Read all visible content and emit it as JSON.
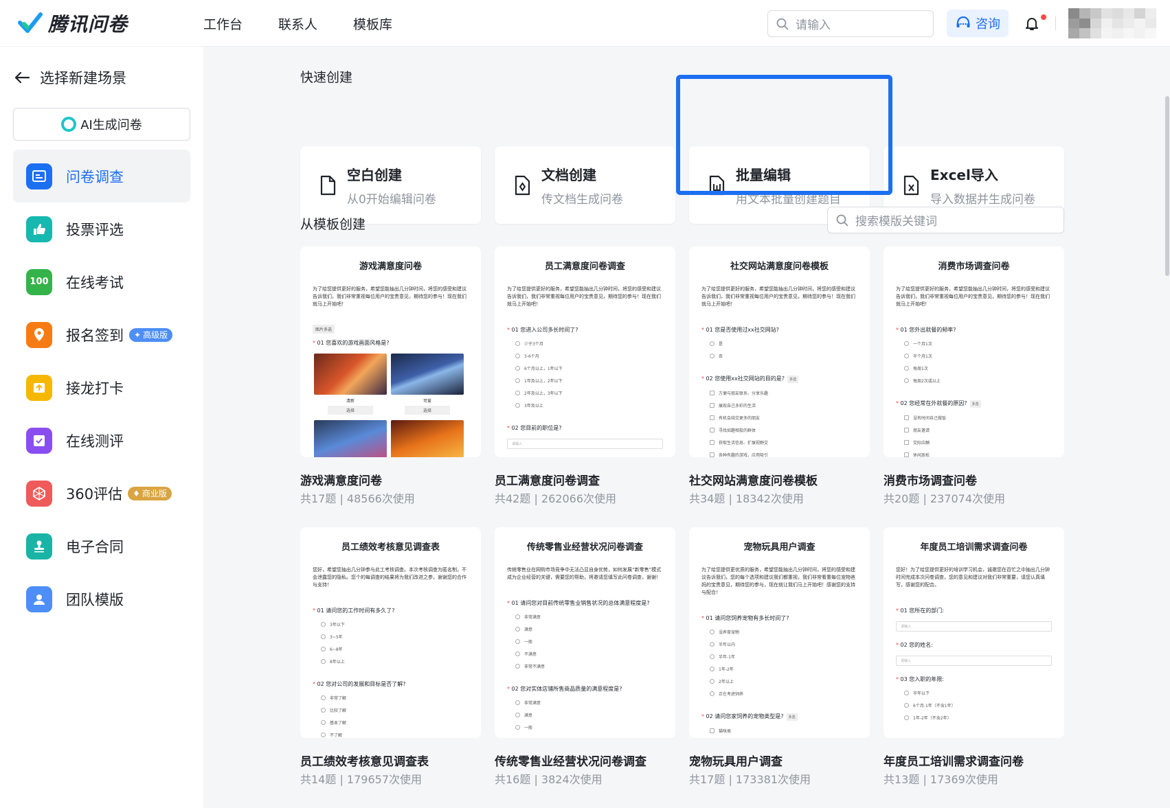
{
  "app": {
    "name": "腾讯问卷"
  },
  "nav": [
    "工作台",
    "联系人",
    "模板库"
  ],
  "header": {
    "search_placeholder": "请输入",
    "consult_label": "咨询"
  },
  "sidebar": {
    "title": "选择新建场景",
    "ai_button": "AI生成问卷",
    "items": [
      {
        "label": "问卷调查",
        "icon": "survey-icon",
        "color": "#1d6ff2",
        "active": true
      },
      {
        "label": "投票评选",
        "icon": "thumbs-up-icon",
        "color": "#17b8b0"
      },
      {
        "label": "在线考试",
        "icon": "score-100-icon",
        "color": "#34b34a"
      },
      {
        "label": "报名签到",
        "icon": "location-pin-icon",
        "color": "#f77b14",
        "badge": "高级版",
        "badge_color": "#4d8ef7"
      },
      {
        "label": "接龙打卡",
        "icon": "upload-icon",
        "color": "#f5b800"
      },
      {
        "label": "在线测评",
        "icon": "check-card-icon",
        "color": "#8a4ef0"
      },
      {
        "label": "360评估",
        "icon": "radar-icon",
        "color": "#ef5a5a",
        "badge": "商业版",
        "badge_color": "#d9a441"
      },
      {
        "label": "电子合同",
        "icon": "stamp-icon",
        "color": "#19b4a6"
      },
      {
        "label": "团队模版",
        "icon": "user-icon",
        "color": "#4d8ef7"
      }
    ]
  },
  "quick_create": {
    "title": "快速创建",
    "items": [
      {
        "title": "空白创建",
        "desc": "从0开始编辑问卷",
        "icon": "blank-file-icon"
      },
      {
        "title": "文档创建",
        "desc": "传文档生成问卷",
        "icon": "doc-create-icon"
      },
      {
        "title": "批量编辑",
        "desc": "用文本批量创建题目",
        "icon": "batch-edit-icon"
      },
      {
        "title": "Excel导入",
        "desc": "导入数据并生成问卷",
        "icon": "excel-import-icon"
      }
    ]
  },
  "templates": {
    "title": "从模板创建",
    "search_placeholder": "搜索模版关键词",
    "items": [
      {
        "name": "游戏满意度问卷",
        "meta": "共17题 | 48566次使用",
        "preview": {
          "title": "游戏满意度问卷",
          "intro": "为了给您提供更好的服务，希望您能抽出几分钟时间，将您的感受和建议告诉我们，我们非常重视每位用户的宝贵意见，期待您的参与！现在我们就马上开始吧！",
          "img_tag": "图片多选",
          "q1": "01 您喜欢的游戏画面风格是?",
          "imgs": [
            {
              "cap": "清新",
              "btn": "选择"
            },
            {
              "cap": "可爱",
              "btn": "选择"
            }
          ]
        }
      },
      {
        "name": "员工满意度问卷调查",
        "meta": "共42题 | 262066次使用",
        "preview": {
          "title": "员工满意度问卷调查",
          "intro": "为了给您提供更好的服务，希望您能抽出几分钟时间，将您的感受和建议告诉我们，我们非常重视每位用户的宝贵意见，期待您的参与！现在我们就马上开始吧！",
          "q1": "01 您进入公司多长时间了?",
          "opts": [
            "少于3个月",
            "3-6个月",
            "6个月以上，1年以下",
            "1年及以上，2年以下",
            "2年及以上，3年以下",
            "3年及以上"
          ],
          "q2": "02 您目前的职位是?",
          "input": "请输入"
        }
      },
      {
        "name": "社交网站满意度问卷模板",
        "meta": "共34题 | 18342次使用",
        "preview": {
          "title": "社交网站满意度问卷模板",
          "intro": "为了给您提供更好的服务，希望您能抽出几分钟时间，将您的感受和建议告诉我们，我们非常重视每位用户的宝贵意见，期待您的参与！现在我们就马上开始吧！",
          "q1": "01 您是否使用过xx社交网站?",
          "opts": [
            "是",
            "否"
          ],
          "q2": "02 您使用xx社交网站的目的是?",
          "tag": "多选",
          "opts2": [
            "方便与朋友联系、分享乐趣",
            "展现自己多彩的生活",
            "有机会结交更多的朋友",
            "寻找如趣相投的群体",
            "获取生活信息、扩展视野交",
            "各种有趣的游戏，应用吸引"
          ]
        }
      },
      {
        "name": "消费市场调查问卷",
        "meta": "共20题 | 237074次使用",
        "preview": {
          "title": "消费市场调查问卷",
          "intro": "为了给您提供更好的服务，希望您能抽出几分钟时间，将您的感受和建议告诉我们，我们非常重视每位用户的宝贵意见，期待您的参与！现在我们就马上开始吧！",
          "q1": "01 您外出就餐的频率?",
          "opts": [
            "一个月1次",
            "半个月1次",
            "每周1次",
            "每周2次或以上"
          ],
          "q2": "02 您经常在外就餐的原因?",
          "tag": "多选",
          "opts2": [
            "没有时间自己做饭",
            "朋友邀请",
            "交际应酬",
            "休闲放松"
          ]
        }
      },
      {
        "name": "员工绩效考核意见调查表",
        "meta": "共14题 | 179657次使用",
        "preview": {
          "title": "员工绩效考核意见调查表",
          "intro": "您好，希望您抽出几分钟参与此工考核调查。本次考核调查为匿名制，不会泄露您的隐私。您个的每调查的结果将为我们改进之参，谢谢您的合作与支持！",
          "q1": "01 请问您的工作时间有多久了?",
          "opts": [
            "3年以下",
            "3~5年",
            "6~8年",
            "8年以上"
          ],
          "q2": "02 您对公司的发展和目标是否了解?",
          "opts2": [
            "非常了解",
            "比较了解",
            "基本了解",
            "不了解"
          ]
        }
      },
      {
        "name": "传统零售业经营状况问卷调查",
        "meta": "共16题 | 3824次使用",
        "preview": {
          "title": "传统零售业经营状况问卷调查",
          "intro": "传统零售业在网购市场竞争中无法凸显自身优势，如何发展“新零售”模式成为企业经营的关键，需要您的帮助，将邀请您填写此问卷调查，谢谢！",
          "q1": "01 请问您对目前传统零售业销售状况的总体满意程度是?",
          "opts": [
            "非常满意",
            "满意",
            "一般",
            "不满意",
            "非常不满意"
          ],
          "q2": "02 您对实体店铺所售商品质量的满意程度是?",
          "opts2": [
            "非常满意",
            "满意",
            "一般"
          ]
        }
      },
      {
        "name": "宠物玩具用户调查",
        "meta": "共17题 | 173381次使用",
        "preview": {
          "title": "宠物玩具用户调查",
          "intro": "为了给您提供更优质的服务，希望您能抽出几分钟时间，将您的感受和建议告诉我们，您的每个选项和建议我们都重视，我们非常看重每位宠物爸妈的宝贵意见，期待您的参与，现在就让我们马上开始吧！感谢您的支持与配合！",
          "q1": "01 请问您饲养宠物有多长时间了?",
          "opts": [
            "没养育宠物",
            "半年以内",
            "半年-1年",
            "1年-2年",
            "2年以上",
            "正在考虑饲养"
          ],
          "q2": "02 请问您家饲养的宠物类型是?",
          "tag": "多选",
          "opts2": [
            "猫咪类"
          ]
        }
      },
      {
        "name": "年度员工培训需求调查问卷",
        "meta": "共13题 | 17369次使用",
        "preview": {
          "title": "年度员工培训需求调查问卷",
          "intro": "您好！为了给您提供更好的培训学习机会，诚邀您在百忙之中抽出几分钟时间完成本次问卷调查，您的意见和建议对我们非常重要，请您认真填写，感谢您的配合。",
          "q1": "01 您所在的部门:",
          "input1": "请输入",
          "q2": "02 您的姓名:",
          "input2": "请输入",
          "q3": "03 您入职的年限:",
          "opts": [
            "半年以下",
            "6个月-1年（不含1年）",
            "1年-2年（不含2年）"
          ]
        }
      }
    ]
  }
}
